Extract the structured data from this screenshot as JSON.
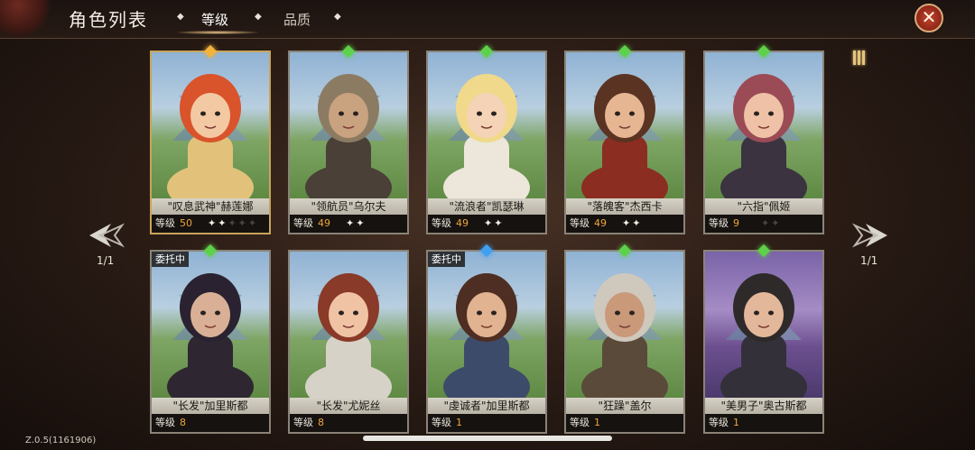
{
  "header": {
    "title": "角色列表",
    "tabs": [
      {
        "label": "等级",
        "active": true
      },
      {
        "label": "品质",
        "active": false
      }
    ],
    "close_icon": "close-icon"
  },
  "pagination": {
    "left": "1/1",
    "right": "1/1"
  },
  "version": "Z.0.5(1161906)",
  "colors": {
    "level_number": "#f0a53c",
    "gem_green": "#5ed14a",
    "gem_gold": "#f2b33d",
    "gem_blue": "#3fa0f0"
  },
  "characters": [
    {
      "name": "\"叹息武神\"赫莲娜",
      "level_label": "等级",
      "level": "50",
      "stars": 2,
      "gem": "gold",
      "tag": ""
    },
    {
      "name": "\"领航员\"乌尔夫",
      "level_label": "等级",
      "level": "49",
      "stars": 2,
      "gem": "green",
      "tag": ""
    },
    {
      "name": "\"流浪者\"凯瑟琳",
      "level_label": "等级",
      "level": "49",
      "stars": 2,
      "gem": "green",
      "tag": ""
    },
    {
      "name": "\"落魄客\"杰西卡",
      "level_label": "等级",
      "level": "49",
      "stars": 2,
      "gem": "green",
      "tag": ""
    },
    {
      "name": "\"六指\"佩姬",
      "level_label": "等级",
      "level": "9",
      "stars": 0,
      "gem": "green",
      "tag": ""
    },
    {
      "name": "\"长发\"加里斯都",
      "level_label": "等级",
      "level": "8",
      "stars": 0,
      "gem": "green",
      "tag": "委托中"
    },
    {
      "name": "\"长发\"尤妮丝",
      "level_label": "等级",
      "level": "8",
      "stars": 0,
      "gem": "",
      "tag": ""
    },
    {
      "name": "\"虔诚者\"加里斯都",
      "level_label": "等级",
      "level": "1",
      "stars": 0,
      "gem": "blue",
      "tag": "委托中"
    },
    {
      "name": "\"狂躁\"盖尔",
      "level_label": "等级",
      "level": "1",
      "stars": 0,
      "gem": "green",
      "tag": ""
    },
    {
      "name": "\"美男子\"奥古斯都",
      "level_label": "等级",
      "level": "1",
      "stars": 0,
      "gem": "green",
      "tag": ""
    }
  ]
}
